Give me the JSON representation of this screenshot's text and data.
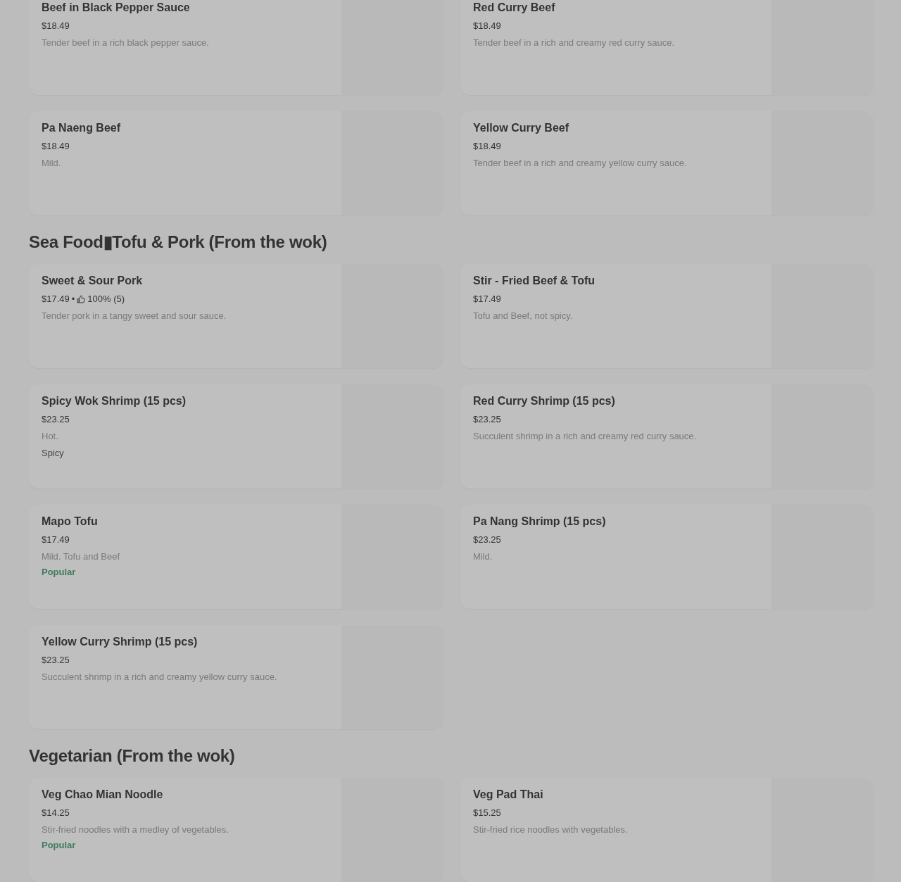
{
  "sections": [
    {
      "items": [
        {
          "name": "Beef in Black Pepper Sauce",
          "price": "$18.49",
          "description": "Tender beef in a rich black pepper sauce."
        },
        {
          "name": "Red Curry Beef",
          "price": "$18.49",
          "description": "Tender beef in a rich and creamy red curry sauce."
        },
        {
          "name": "Pa Naeng Beef",
          "price": "$18.49",
          "description": "Mild."
        },
        {
          "name": "Yellow Curry Beef",
          "price": "$18.49",
          "description": "Tender beef in a rich and creamy yellow curry sauce."
        }
      ]
    },
    {
      "title": "Sea Food▮Tofu & Pork (From the wok)",
      "items": [
        {
          "name": "Sweet & Sour Pork",
          "price": "$17.49",
          "separator": "•",
          "rating": "100% (5)",
          "description": "Tender pork in a tangy sweet and sour sauce."
        },
        {
          "name": "Stir - Fried Beef & Tofu",
          "price": "$17.49",
          "description": "Tofu and Beef, not spicy."
        },
        {
          "name": "Spicy Wok Shrimp (15 pcs)",
          "price": "$23.25",
          "description": "Hot.",
          "tag": {
            "text": "Spicy",
            "kind": "plain"
          }
        },
        {
          "name": "Red Curry Shrimp (15 pcs)",
          "price": "$23.25",
          "description": "Succulent shrimp in a rich and creamy red curry sauce."
        },
        {
          "name": "Mapo Tofu",
          "price": "$17.49",
          "description": "Mild. Tofu and Beef",
          "tag": {
            "text": "Popular",
            "kind": "popular"
          }
        },
        {
          "name": "Pa Nang Shrimp (15 pcs)",
          "price": "$23.25",
          "description": "Mild."
        },
        {
          "name": "Yellow Curry Shrimp (15 pcs)",
          "price": "$23.25",
          "description": "Succulent shrimp in a rich and creamy yellow curry sauce."
        }
      ]
    },
    {
      "title": "Vegetarian (From the wok)",
      "items": [
        {
          "name": "Veg Chao Mian Noodle",
          "price": "$14.25",
          "description": "Stir-fried noodles with a medley of vegetables.",
          "tag": {
            "text": "Popular",
            "kind": "popular"
          }
        },
        {
          "name": "Veg Pad Thai",
          "price": "$15.25",
          "description": "Stir-fried rice noodles with vegetables."
        }
      ]
    }
  ]
}
